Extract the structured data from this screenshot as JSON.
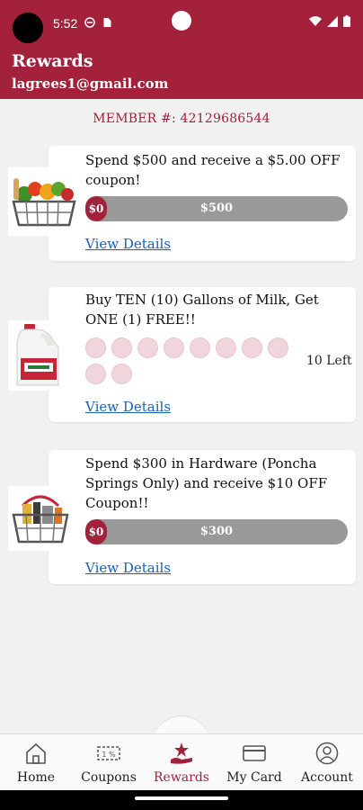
{
  "status": {
    "time": "5:52"
  },
  "header": {
    "title": "Rewards",
    "email": "lagrees1@gmail.com"
  },
  "member": {
    "label": "MEMBER #: 42129686544"
  },
  "rewards": [
    {
      "title": "Spend $500 and receive a $5.00 OFF coupon!",
      "progress_start": "$0",
      "progress_end": "$500",
      "progress_fraction": 0,
      "link": "View Details",
      "image": "grocery-basket-image"
    },
    {
      "title": "Buy TEN (10) Gallons of Milk, Get ONE (1) FREE!!",
      "punches_total": 10,
      "punches_filled": 0,
      "left_text": "10 Left",
      "link": "View Details",
      "image": "milk-jug-image"
    },
    {
      "title": "Spend $300 in Hardware (Poncha Springs Only) and receive $10 OFF Coupon!!",
      "progress_start": "$0",
      "progress_end": "$300",
      "progress_fraction": 0,
      "link": "View Details",
      "image": "hardware-basket-image"
    }
  ],
  "nav": {
    "items": [
      {
        "label": "Home",
        "icon": "home-icon"
      },
      {
        "label": "Coupons",
        "icon": "coupon-icon"
      },
      {
        "label": "Rewards",
        "icon": "rewards-icon",
        "active": true
      },
      {
        "label": "My Card",
        "icon": "card-icon"
      },
      {
        "label": "Account",
        "icon": "account-icon"
      }
    ]
  },
  "colors": {
    "brand": "#a3213a",
    "link": "#1a5fb4",
    "progress_track": "#999999",
    "punch": "#f0d6dc"
  }
}
